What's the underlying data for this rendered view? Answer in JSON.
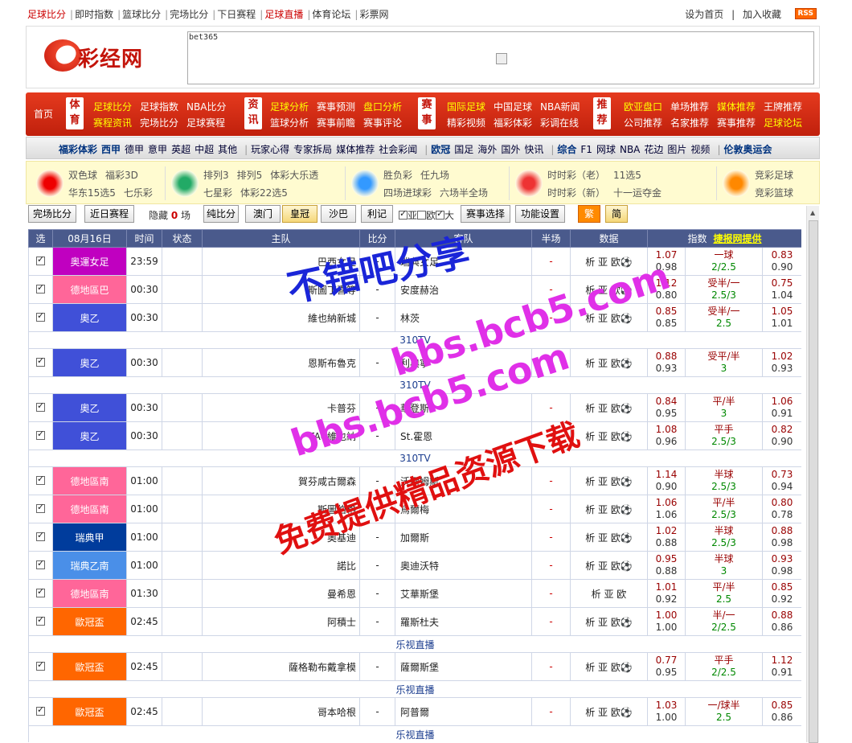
{
  "top_nav": {
    "links": [
      "足球比分",
      "即时指数",
      "篮球比分",
      "完场比分",
      "下日赛程",
      "足球直播",
      "体育论坛",
      "彩票网"
    ],
    "set_home": "设为首页",
    "add_fav": "加入收藏",
    "rss": "RSS"
  },
  "header": {
    "logo_text": "彩经网",
    "ad_label": "bet365"
  },
  "red_nav": {
    "home": "首页",
    "groups": [
      {
        "cat": "体育",
        "row1": [
          "足球比分",
          "足球指数",
          "NBA比分"
        ],
        "row2": [
          "赛程资讯",
          "完场比分",
          "足球赛程"
        ]
      },
      {
        "cat": "资讯",
        "row1": [
          "足球分析",
          "赛事预测",
          "盘口分析"
        ],
        "row2": [
          "篮球分析",
          "赛事前瞻",
          "赛事评论"
        ]
      },
      {
        "cat": "赛事",
        "row1": [
          "国际足球",
          "中国足球",
          "NBA新闻"
        ],
        "row2": [
          "精彩视频",
          "福彩体彩",
          "彩调在线"
        ]
      },
      {
        "cat": "推荐",
        "row1": [
          "欧亚盘口",
          "单场推荐",
          "媒体推荐",
          "王牌推荐"
        ],
        "row2": [
          "公司推荐",
          "名家推荐",
          "赛事推荐",
          "足球论坛"
        ]
      }
    ]
  },
  "sub_nav": {
    "items": [
      "福彩体彩",
      "西甲",
      "德甲",
      "意甲",
      "英超",
      "中超",
      "其他",
      "玩家心得",
      "专家拆局",
      "媒体推荐",
      "社会彩闻",
      "欧冠",
      "国足",
      "海外",
      "国外",
      "快讯",
      "综合",
      "F1",
      "网球",
      "NBA",
      "花边",
      "图片",
      "视频",
      "伦敦奥运会"
    ]
  },
  "lottery": [
    {
      "row1": [
        "双色球",
        "福彩3D"
      ],
      "row2": [
        "华东15选5",
        "七乐彩"
      ]
    },
    {
      "row1": [
        "排列3",
        "排列5",
        "体彩大乐透"
      ],
      "row2": [
        "七星彩",
        "体彩22选5"
      ]
    },
    {
      "row1": [
        "胜负彩",
        "任九场"
      ],
      "row2": [
        "四场进球彩",
        "六场半全场"
      ]
    },
    {
      "row1": [
        "时时彩（老）",
        "11选5"
      ],
      "row2": [
        "时时彩（新）",
        "十一运夺金"
      ]
    },
    {
      "row1": [
        "竞彩足球"
      ],
      "row2": [
        "竞彩篮球"
      ]
    }
  ],
  "toolbar": {
    "full_score": "完场比分",
    "recent": "近日赛程",
    "hidden_label": "隐藏",
    "hidden_count": "0",
    "hidden_unit": "场",
    "pure": "纯比分",
    "aomen": "澳门",
    "huangguan": "皇冠",
    "shaba": "沙巴",
    "liji": "利记",
    "ya": "亚",
    "ou": "欧",
    "da": "大",
    "match_select": "赛事选择",
    "settings": "功能设置",
    "fan": "繁",
    "jian": "简"
  },
  "table": {
    "headers": [
      "选",
      "08月16日",
      "时间",
      "状态",
      "主队",
      "比分",
      "客队",
      "半场",
      "数据",
      "指数"
    ],
    "provider": "捷报网提供",
    "rows": [
      {
        "league": "奥運女足",
        "color": "#c000c0",
        "time": "23:59",
        "home": "巴西女足",
        "score": "-",
        "away": "瑞典女足",
        "half": "-",
        "data": "析 亚 欧⚽",
        "o1": [
          "1.07",
          "0.98"
        ],
        "hc": [
          "一球",
          "2/2.5"
        ],
        "o2": [
          "0.83",
          "0.90"
        ]
      },
      {
        "league": "德地區巴",
        "color": "#ff6699",
        "time": "00:30",
        "home": "斯圖丁喜等",
        "score": "-",
        "away": "安度赫治",
        "half": "-",
        "data": "析 亚 欧⚽",
        "o1": [
          "1.12",
          "0.80"
        ],
        "hc": [
          "受半/一",
          "2.5/3"
        ],
        "o2": [
          "0.75",
          "1.04"
        ]
      },
      {
        "league": "奧乙",
        "color": "#4050d8",
        "time": "00:30",
        "home": "維也納新城",
        "score": "-",
        "away": "林茨",
        "half": "-",
        "data": "析 亚 欧⚽",
        "o1": [
          "0.85",
          "0.85"
        ],
        "hc": [
          "受半/一",
          "2.5"
        ],
        "o2": [
          "1.05",
          "1.01"
        ]
      },
      {
        "gap": "310TV"
      },
      {
        "league": "奧乙",
        "color": "#4050d8",
        "time": "00:30",
        "home": "恩斯布魯克",
        "score": "-",
        "away": "利典寧",
        "half": "-",
        "data": "析 亚 欧⚽",
        "o1": [
          "0.88",
          "0.93"
        ],
        "hc": [
          "受平/半",
          "3"
        ],
        "o2": [
          "1.02",
          "0.93"
        ]
      },
      {
        "gap": "310TV"
      },
      {
        "league": "奧乙",
        "color": "#4050d8",
        "time": "00:30",
        "home": "卡普芬",
        "score": "-",
        "away": "華登斯",
        "half": "-",
        "data": "析 亚 欧⚽",
        "o1": [
          "0.84",
          "0.95"
        ],
        "hc": [
          "平/半",
          "3"
        ],
        "o2": [
          "1.06",
          "0.91"
        ]
      },
      {
        "league": "奧乙",
        "color": "#4050d8",
        "time": "00:30",
        "home": "FAC維也納",
        "score": "-",
        "away": "St.霍恩",
        "half": "-",
        "data": "析 亚 欧⚽",
        "o1": [
          "1.08",
          "0.96"
        ],
        "hc": [
          "平手",
          "2.5/3"
        ],
        "o2": [
          "0.82",
          "0.90"
        ]
      },
      {
        "gap": "310TV"
      },
      {
        "league": "德地區南",
        "color": "#ff6699",
        "time": "01:00",
        "home": "賀芬咸古爾森",
        "score": "-",
        "away": "沃爾姆斯",
        "half": "-",
        "data": "析 亚 欧⚽",
        "o1": [
          "1.14",
          "0.90"
        ],
        "hc": [
          "半球",
          "2.5/3"
        ],
        "o2": [
          "0.73",
          "0.94"
        ]
      },
      {
        "league": "德地區南",
        "color": "#ff6699",
        "time": "01:00",
        "home": "斯圖伯格",
        "score": "-",
        "away": "烏爾梅",
        "half": "-",
        "data": "析 亚 欧⚽",
        "o1": [
          "1.06",
          "1.06"
        ],
        "hc": [
          "平/半",
          "2.5/3"
        ],
        "o2": [
          "0.80",
          "0.78"
        ]
      },
      {
        "league": "瑞典甲",
        "color": "#003c9c",
        "time": "01:00",
        "home": "奧基迪",
        "score": "-",
        "away": "加爾斯",
        "half": "-",
        "data": "析 亚 欧⚽",
        "o1": [
          "1.02",
          "0.88"
        ],
        "hc": [
          "半球",
          "2.5/3"
        ],
        "o2": [
          "0.88",
          "0.98"
        ]
      },
      {
        "league": "瑞典乙南",
        "color": "#4a8fe8",
        "time": "01:00",
        "home": "諾比",
        "score": "-",
        "away": "奧迪沃特",
        "half": "-",
        "data": "析 亚 欧⚽",
        "o1": [
          "0.95",
          "0.88"
        ],
        "hc": [
          "半球",
          "3"
        ],
        "o2": [
          "0.93",
          "0.98"
        ]
      },
      {
        "league": "德地區南",
        "color": "#ff6699",
        "time": "01:30",
        "home": "曼希恩",
        "score": "-",
        "away": "艾華斯堡",
        "half": "-",
        "data": "析 亚 欧",
        "o1": [
          "1.01",
          "0.92"
        ],
        "hc": [
          "平/半",
          "2.5"
        ],
        "o2": [
          "0.85",
          "0.92"
        ]
      },
      {
        "league": "歐冠盃",
        "color": "#ff6600",
        "time": "02:45",
        "home": "阿積士",
        "score": "-",
        "away": "羅斯杜夫",
        "half": "-",
        "data": "析 亚 欧⚽",
        "o1": [
          "1.00",
          "1.00"
        ],
        "hc": [
          "半/一",
          "2/2.5"
        ],
        "o2": [
          "0.88",
          "0.86"
        ]
      },
      {
        "gap": "乐视直播"
      },
      {
        "league": "歐冠盃",
        "color": "#ff6600",
        "time": "02:45",
        "home": "薩格勒布戴拿模",
        "score": "-",
        "away": "薩爾斯堡",
        "half": "-",
        "data": "析 亚 欧⚽",
        "o1": [
          "0.77",
          "0.95"
        ],
        "hc": [
          "平手",
          "2/2.5"
        ],
        "o2": [
          "1.12",
          "0.91"
        ]
      },
      {
        "gap": "乐视直播"
      },
      {
        "league": "歐冠盃",
        "color": "#ff6600",
        "time": "02:45",
        "home": "哥本哈根",
        "score": "-",
        "away": "阿普爾",
        "half": "-",
        "data": "析 亚 欧⚽",
        "o1": [
          "1.03",
          "1.00"
        ],
        "hc": [
          "一/球半",
          "2.5"
        ],
        "o2": [
          "0.85",
          "0.86"
        ]
      },
      {
        "gap": "乐视直播"
      }
    ]
  },
  "watermark": {
    "line1": "不错吧分享",
    "line2": "bbs.bcb5.com",
    "line3": "bbs.bcb5.com",
    "line4": "免费提供精品资源下载"
  }
}
